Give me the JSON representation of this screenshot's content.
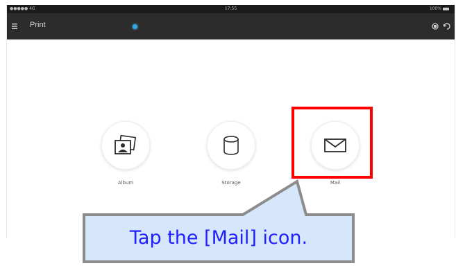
{
  "status_bar": {
    "carrier": "●●●●● 4G",
    "time": "17:55",
    "battery": "100%"
  },
  "app_bar": {
    "title": "Print",
    "icons": [
      "menu-icon",
      "status-dot",
      "cloud-icon",
      "refresh-icon"
    ]
  },
  "sources": [
    {
      "label": "Album",
      "icon": "album-icon"
    },
    {
      "label": "Storage",
      "icon": "storage-icon"
    },
    {
      "label": "Mail",
      "icon": "mail-icon"
    }
  ],
  "callout": {
    "text": "Tap the [Mail] icon."
  },
  "colors": {
    "highlight": "#ff0000",
    "callout_fill": "#d6e7fb",
    "callout_text": "#1f1fff",
    "app_bar": "#2c2c2c",
    "status_dot": "#2fa8e4"
  }
}
